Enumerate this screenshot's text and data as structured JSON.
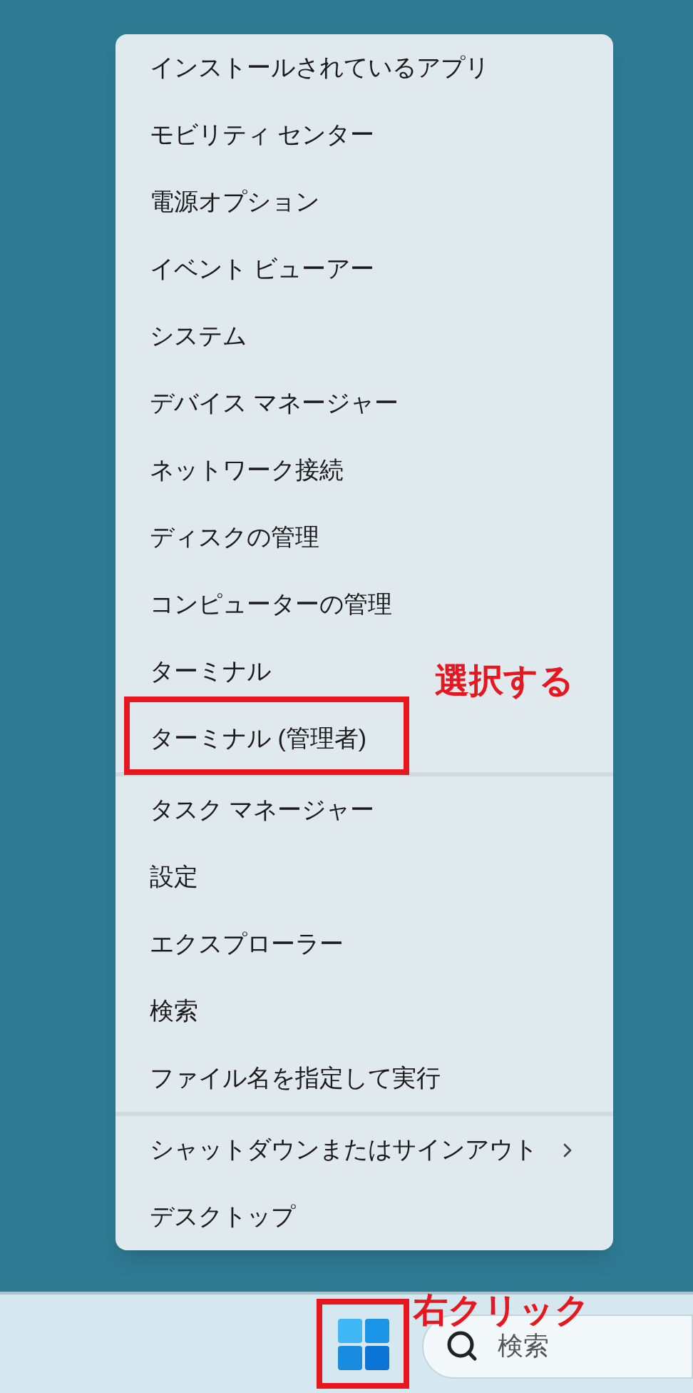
{
  "context_menu": {
    "groups": [
      {
        "items": [
          {
            "label": "インストールされているアプリ",
            "kind": "item",
            "annotated": false
          },
          {
            "label": "モビリティ センター",
            "kind": "item",
            "annotated": false
          },
          {
            "label": "電源オプション",
            "kind": "item",
            "annotated": false
          },
          {
            "label": "イベント ビューアー",
            "kind": "item",
            "annotated": false
          },
          {
            "label": "システム",
            "kind": "item",
            "annotated": false
          },
          {
            "label": "デバイス マネージャー",
            "kind": "item",
            "annotated": false
          },
          {
            "label": "ネットワーク接続",
            "kind": "item",
            "annotated": false
          },
          {
            "label": "ディスクの管理",
            "kind": "item",
            "annotated": false
          },
          {
            "label": "コンピューターの管理",
            "kind": "item",
            "annotated": false
          },
          {
            "label": "ターミナル",
            "kind": "item",
            "annotated": false
          },
          {
            "label": "ターミナル (管理者)",
            "kind": "item",
            "annotated": true,
            "note": "選択する"
          }
        ]
      },
      {
        "items": [
          {
            "label": "タスク マネージャー",
            "kind": "item",
            "annotated": false
          },
          {
            "label": "設定",
            "kind": "item",
            "annotated": false
          },
          {
            "label": "エクスプローラー",
            "kind": "item",
            "annotated": false
          },
          {
            "label": "検索",
            "kind": "item",
            "annotated": false
          },
          {
            "label": "ファイル名を指定して実行",
            "kind": "item",
            "annotated": false
          }
        ]
      },
      {
        "items": [
          {
            "label": "シャットダウンまたはサインアウト",
            "kind": "submenu",
            "annotated": false
          },
          {
            "label": "デスクトップ",
            "kind": "item",
            "annotated": false
          }
        ]
      }
    ]
  },
  "taskbar": {
    "start_button": {
      "annotated": true,
      "note": "右クリック"
    },
    "search": {
      "placeholder": "検索"
    }
  }
}
